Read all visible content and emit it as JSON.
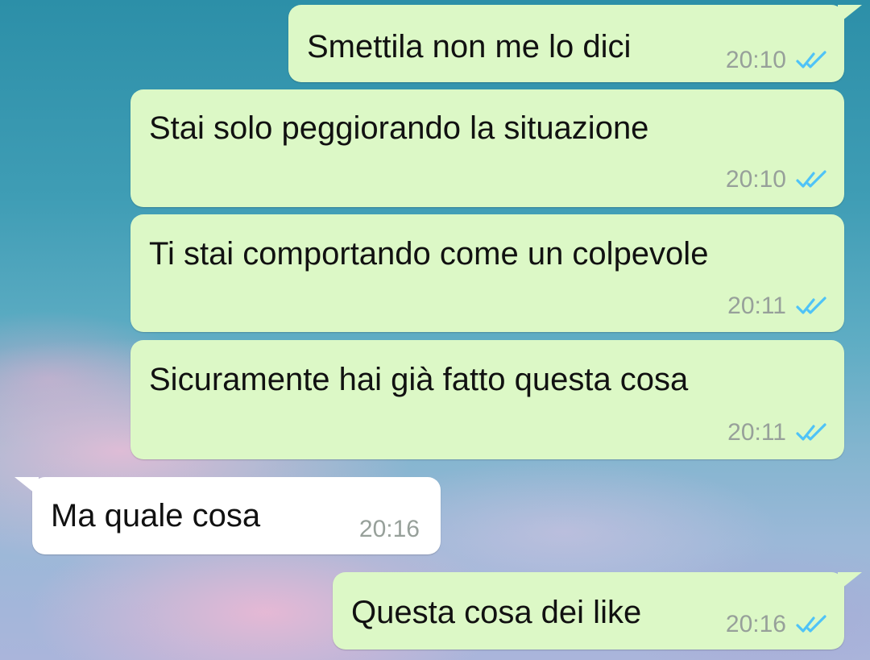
{
  "conversation": {
    "messages": [
      {
        "text": "Smettila non me lo dici",
        "time": "20:10",
        "direction": "outgoing",
        "status": "read"
      },
      {
        "text": "Stai solo peggiorando la situazione",
        "time": "20:10",
        "direction": "outgoing",
        "status": "read"
      },
      {
        "text": "Ti stai comportando come un colpevole",
        "time": "20:11",
        "direction": "outgoing",
        "status": "read"
      },
      {
        "text": "Sicuramente hai già fatto questa cosa",
        "time": "20:11",
        "direction": "outgoing",
        "status": "read"
      },
      {
        "text": "Ma quale cosa",
        "time": "20:16",
        "direction": "incoming"
      },
      {
        "text": "Questa cosa dei like",
        "time": "20:16",
        "direction": "outgoing",
        "status": "read"
      }
    ]
  },
  "icons": {
    "read_receipt": "double-check-icon"
  },
  "colors": {
    "outgoing_bubble": "#dcf8c6",
    "incoming_bubble": "#ffffff",
    "timestamp": "#97a09a",
    "read_ticks": "#4fc3f7"
  }
}
